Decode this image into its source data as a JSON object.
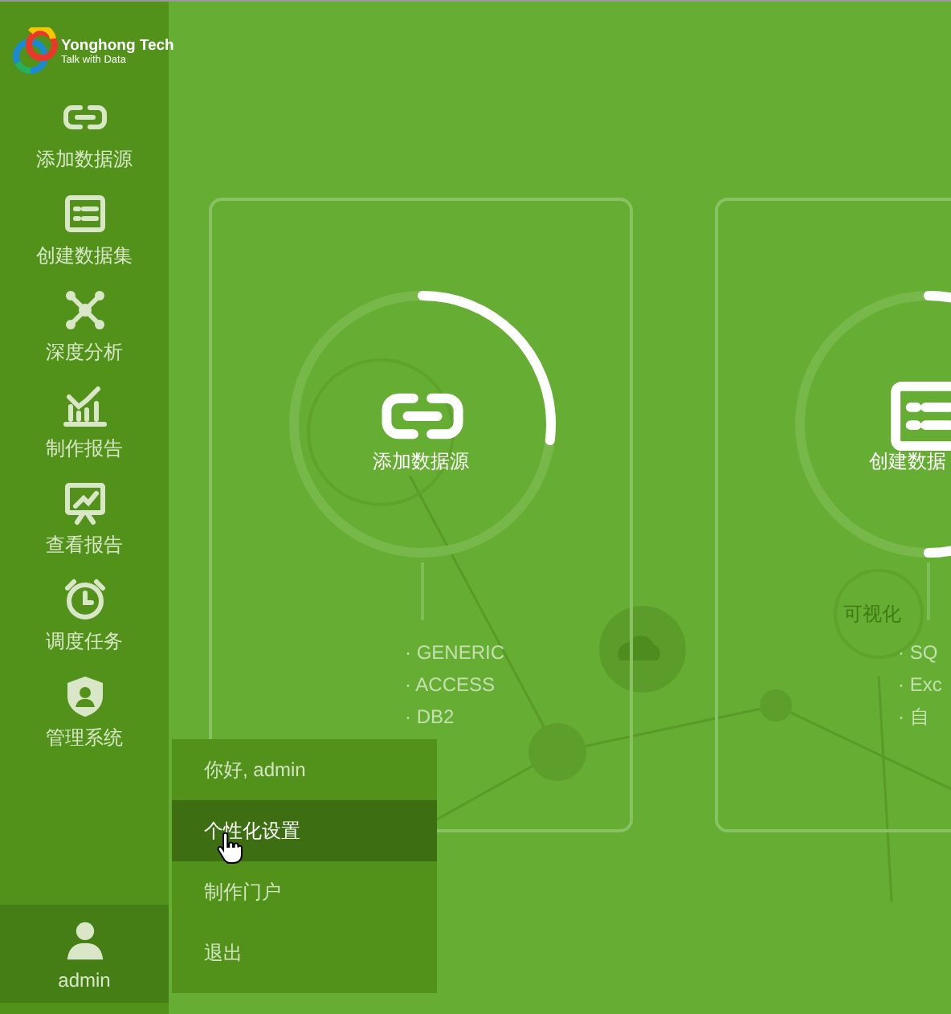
{
  "logo": {
    "name": "Yonghong Tech",
    "tagline": "Talk with Data"
  },
  "sidebar": {
    "items": [
      {
        "label": "添加数据源"
      },
      {
        "label": "创建数据集"
      },
      {
        "label": "深度分析"
      },
      {
        "label": "制作报告"
      },
      {
        "label": "查看报告"
      },
      {
        "label": "调度任务"
      },
      {
        "label": "管理系统"
      }
    ],
    "user": {
      "label": "admin",
      "selected": true
    }
  },
  "background": {
    "bubble_label": "可视化"
  },
  "cards": [
    {
      "title": "添加数据源",
      "level": 0.27,
      "items": [
        "· GENERIC",
        "· ACCESS",
        "· DB2"
      ]
    },
    {
      "title": "创建数据",
      "items": [
        "· SQ",
        "· Exc",
        "· 自"
      ]
    }
  ],
  "user_menu": {
    "items": [
      {
        "label": "你好, admin",
        "selected": false
      },
      {
        "label": "个性化设置",
        "selected": true
      },
      {
        "label": "制作门户",
        "selected": false
      },
      {
        "label": "退出",
        "selected": false
      }
    ]
  }
}
